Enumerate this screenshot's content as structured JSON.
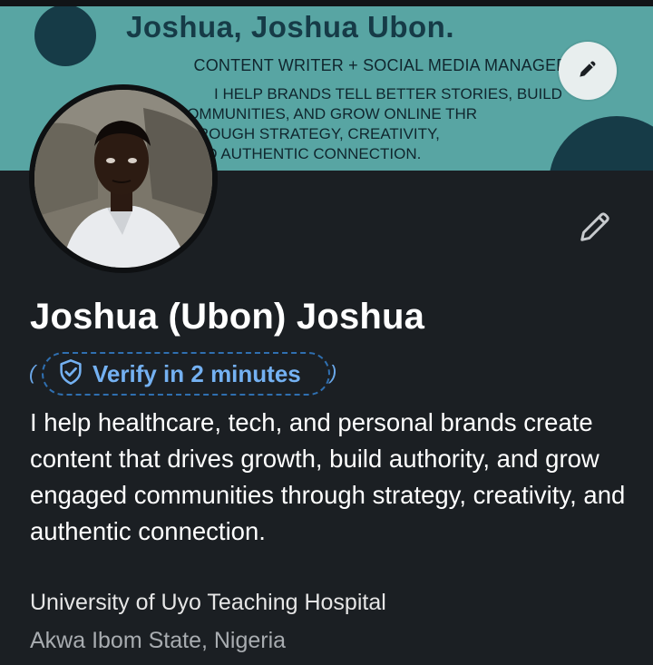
{
  "banner": {
    "title": "Joshua, Joshua Ubon.",
    "subtitle": "CONTENT WRITER + SOCIAL MEDIA MANAGER",
    "description_lines": [
      "I HELP BRANDS TELL BETTER STORIES, BUILD",
      "COMMUNITIES, AND GROW ONLINE THR",
      "THROUGH STRATEGY, CREATIVITY,",
      "AND AUTHENTIC CONNECTION."
    ],
    "colors": {
      "background": "#58a5a3",
      "accent": "#163b47"
    }
  },
  "icons": {
    "edit_banner": "pencil-icon",
    "edit_profile": "pencil-icon",
    "verify": "shield-check-icon"
  },
  "profile": {
    "name": "Joshua (Ubon) Joshua",
    "verify_label": "Verify in 2 minutes",
    "headline": "I help healthcare, tech, and personal brands create content that drives growth, build authority, and grow engaged communities through strategy, creativity, and authentic connection.",
    "institution": "University of Uyo Teaching Hospital",
    "location": "Akwa Ibom State, Nigeria"
  },
  "colors": {
    "page_background": "#1b1f23",
    "verify_blue": "#74b1f2"
  }
}
